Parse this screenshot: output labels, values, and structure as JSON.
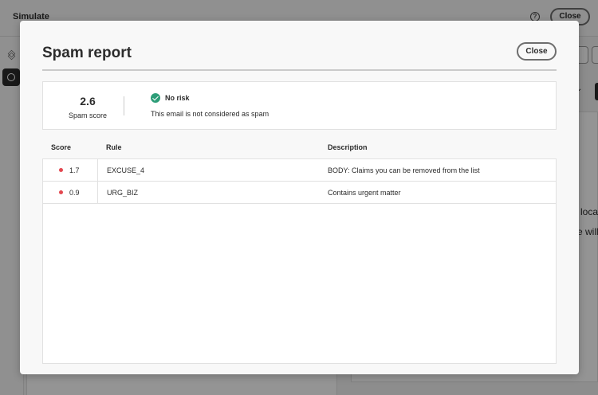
{
  "app": {
    "title": "Simulate",
    "help_icon": "help-circle-icon",
    "close_label": "Close"
  },
  "background_text": {
    "line1": "n loca",
    "line2": "e will"
  },
  "modal": {
    "title": "Spam report",
    "close_label": "Close",
    "summary": {
      "score": "2.6",
      "score_label": "Spam score",
      "risk_icon": "checkmark-circle-icon",
      "risk_color": "#2d9d78",
      "risk_title": "No risk",
      "risk_description": "This email is not considered as spam"
    },
    "table": {
      "columns": [
        "Score",
        "Rule",
        "Description"
      ],
      "severity_color": "#e34850",
      "rows": [
        {
          "score": "1.7",
          "rule": "EXCUSE_4",
          "description": "BODY: Claims you can be removed from the list"
        },
        {
          "score": "0.9",
          "rule": "URG_BIZ",
          "description": "Contains urgent matter"
        }
      ]
    }
  }
}
